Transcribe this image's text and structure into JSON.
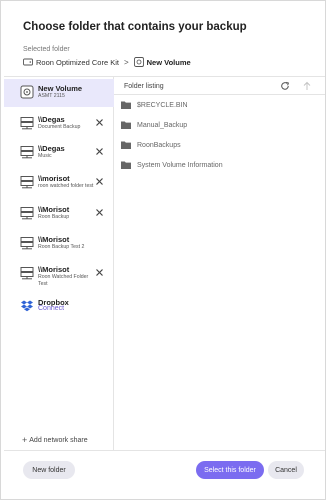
{
  "dialog": {
    "title": "Choose folder that contains your backup",
    "selected_label": "Selected folder",
    "breadcrumb": {
      "root": "Roon Optimized Core Kit",
      "separator": ">",
      "current": "New Volume"
    }
  },
  "sidebar": {
    "items": [
      {
        "title": "New Volume",
        "subtitle": "ASMT 2115",
        "icon": "drive-icon",
        "active": true,
        "removable": false
      },
      {
        "title": "\\\\Degas",
        "subtitle": "Document Backup",
        "icon": "server-icon",
        "removable": true
      },
      {
        "title": "\\\\Degas",
        "subtitle": "Music",
        "icon": "server-icon",
        "removable": true
      },
      {
        "title": "\\\\morisot",
        "subtitle": "roon watched folder test",
        "icon": "server-icon",
        "removable": true
      },
      {
        "title": "\\\\Morisot",
        "subtitle": "Roon Backup",
        "icon": "server-icon",
        "removable": true
      },
      {
        "title": "\\\\Morisot",
        "subtitle": "Roon Backup Test 2",
        "icon": "server-icon",
        "removable": false
      },
      {
        "title": "\\\\Morisot",
        "subtitle": "Roon Watched Folder Test",
        "icon": "server-icon",
        "removable": true
      },
      {
        "title": "Dropbox",
        "subtitle": "Connect",
        "icon": "dropbox-icon",
        "removable": false
      }
    ],
    "add_share": "Add network share"
  },
  "listing": {
    "title": "Folder listing",
    "folders": [
      "$RECYCLE.BIN",
      "Manual_Backup",
      "RoonBackups",
      "System Volume Information"
    ]
  },
  "buttons": {
    "new_folder": "New folder",
    "select": "Select this folder",
    "cancel": "Cancel"
  },
  "colors": {
    "accent": "#7b6cf0",
    "active_bg": "#e9e8fb",
    "link": "#6b5ad3"
  }
}
